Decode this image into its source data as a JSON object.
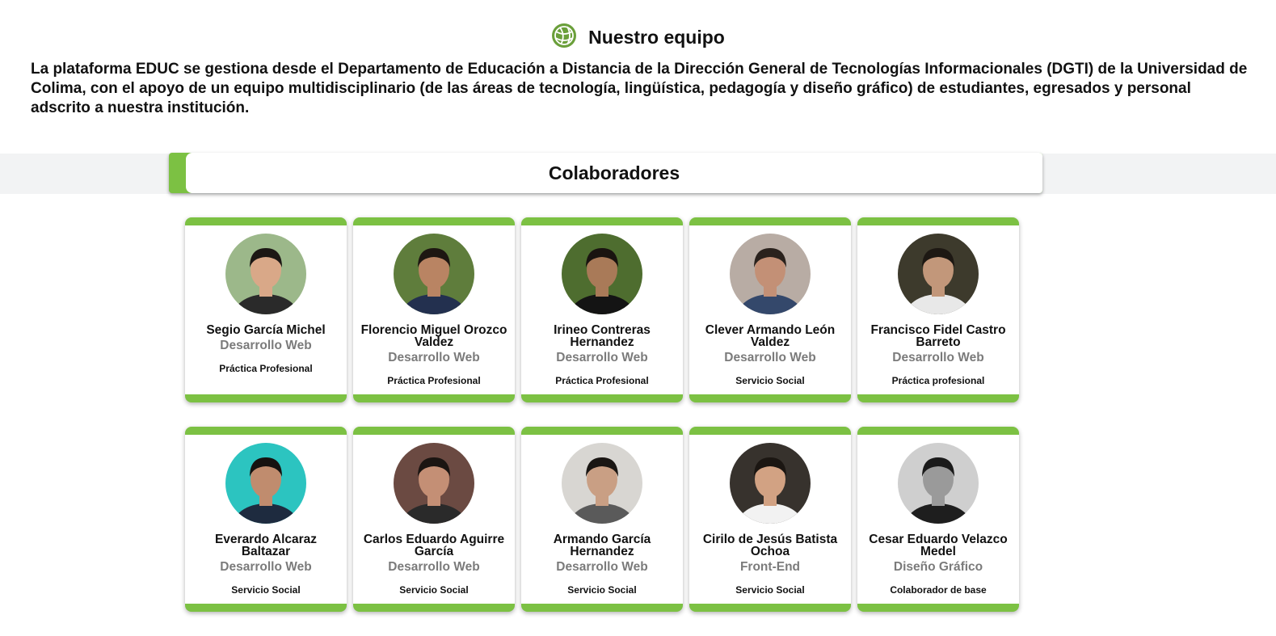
{
  "header": {
    "icon": "globe-icon",
    "accent": "#6a9f3a",
    "title": "Nuestro equipo"
  },
  "intro": {
    "text": "La plataforma EDUC se gestiona desde el Departamento de Educación a Distancia de la Dirección General de Tecnologías Informacionales (DGTI) de la Universidad de Colima, con el apoyo de un equipo multidisciplinario (de las áreas de tecnología, lingüística, pedagogía y diseño gráfico) de estudiantes, egresados y personal adscrito a nuestra institución."
  },
  "section": {
    "title": "Colaboradores",
    "accent": "#7cc143"
  },
  "members": [
    {
      "name": "Segio García Michel",
      "role": "Desarrollo Web",
      "type": "Práctica Profesional",
      "bg": "#9cb88a",
      "skin": "#d9a888",
      "shirt": "#2a2a2a",
      "hair": "#1c1714"
    },
    {
      "name": "Florencio Miguel Orozco Valdez",
      "role": "Desarrollo Web",
      "type": "Práctica Profesional",
      "bg": "#5f7d3c",
      "skin": "#b98463",
      "shirt": "#23304f",
      "hair": "#1e1712"
    },
    {
      "name": "Irineo Contreras Hernandez",
      "role": "Desarrollo Web",
      "type": "Práctica Profesional",
      "bg": "#4e6d2f",
      "skin": "#a97a58",
      "shirt": "#141414",
      "hair": "#1a1410"
    },
    {
      "name": "Clever Armando León Valdez",
      "role": "Desarrollo Web",
      "type": "Servicio Social",
      "bg": "#b8aca4",
      "skin": "#c39076",
      "shirt": "#34486b",
      "hair": "#2a221d"
    },
    {
      "name": "Francisco Fidel Castro Barreto",
      "role": "Desarrollo Web",
      "type": "Práctica profesional",
      "bg": "#3d3a2c",
      "skin": "#c2977a",
      "shirt": "#e8e8e8",
      "hair": "#1d1813"
    },
    {
      "name": "Everardo Alcaraz Baltazar",
      "role": "Desarrollo Web",
      "type": "Servicio Social",
      "bg": "#2cc4c0",
      "skin": "#c08c6e",
      "shirt": "#1e2b3f",
      "hair": "#161210"
    },
    {
      "name": "Carlos Eduardo Aguirre García",
      "role": "Desarrollo Web",
      "type": "Servicio Social",
      "bg": "#6b4a42",
      "skin": "#c48f75",
      "shirt": "#2a2a2a",
      "hair": "#1b1512"
    },
    {
      "name": "Armando García Hernandez",
      "role": "Desarrollo Web",
      "type": "Servicio Social",
      "bg": "#d8d6d2",
      "skin": "#c99f84",
      "shirt": "#5a5a5a",
      "hair": "#1a1613"
    },
    {
      "name": "Cirilo de Jesús Batista Ochoa",
      "role": "Front-End",
      "type": "Servicio Social",
      "bg": "#37322d",
      "skin": "#d2a283",
      "shirt": "#f2f2f2",
      "hair": "#1b1612"
    },
    {
      "name": "Cesar Eduardo Velazco Medel",
      "role": "Diseño Gráfico",
      "type": "Colaborador de base",
      "bg": "#cfcfcf",
      "skin": "#9a9a9a",
      "shirt": "#1e1e1e",
      "hair": "#1a1a1a"
    }
  ]
}
